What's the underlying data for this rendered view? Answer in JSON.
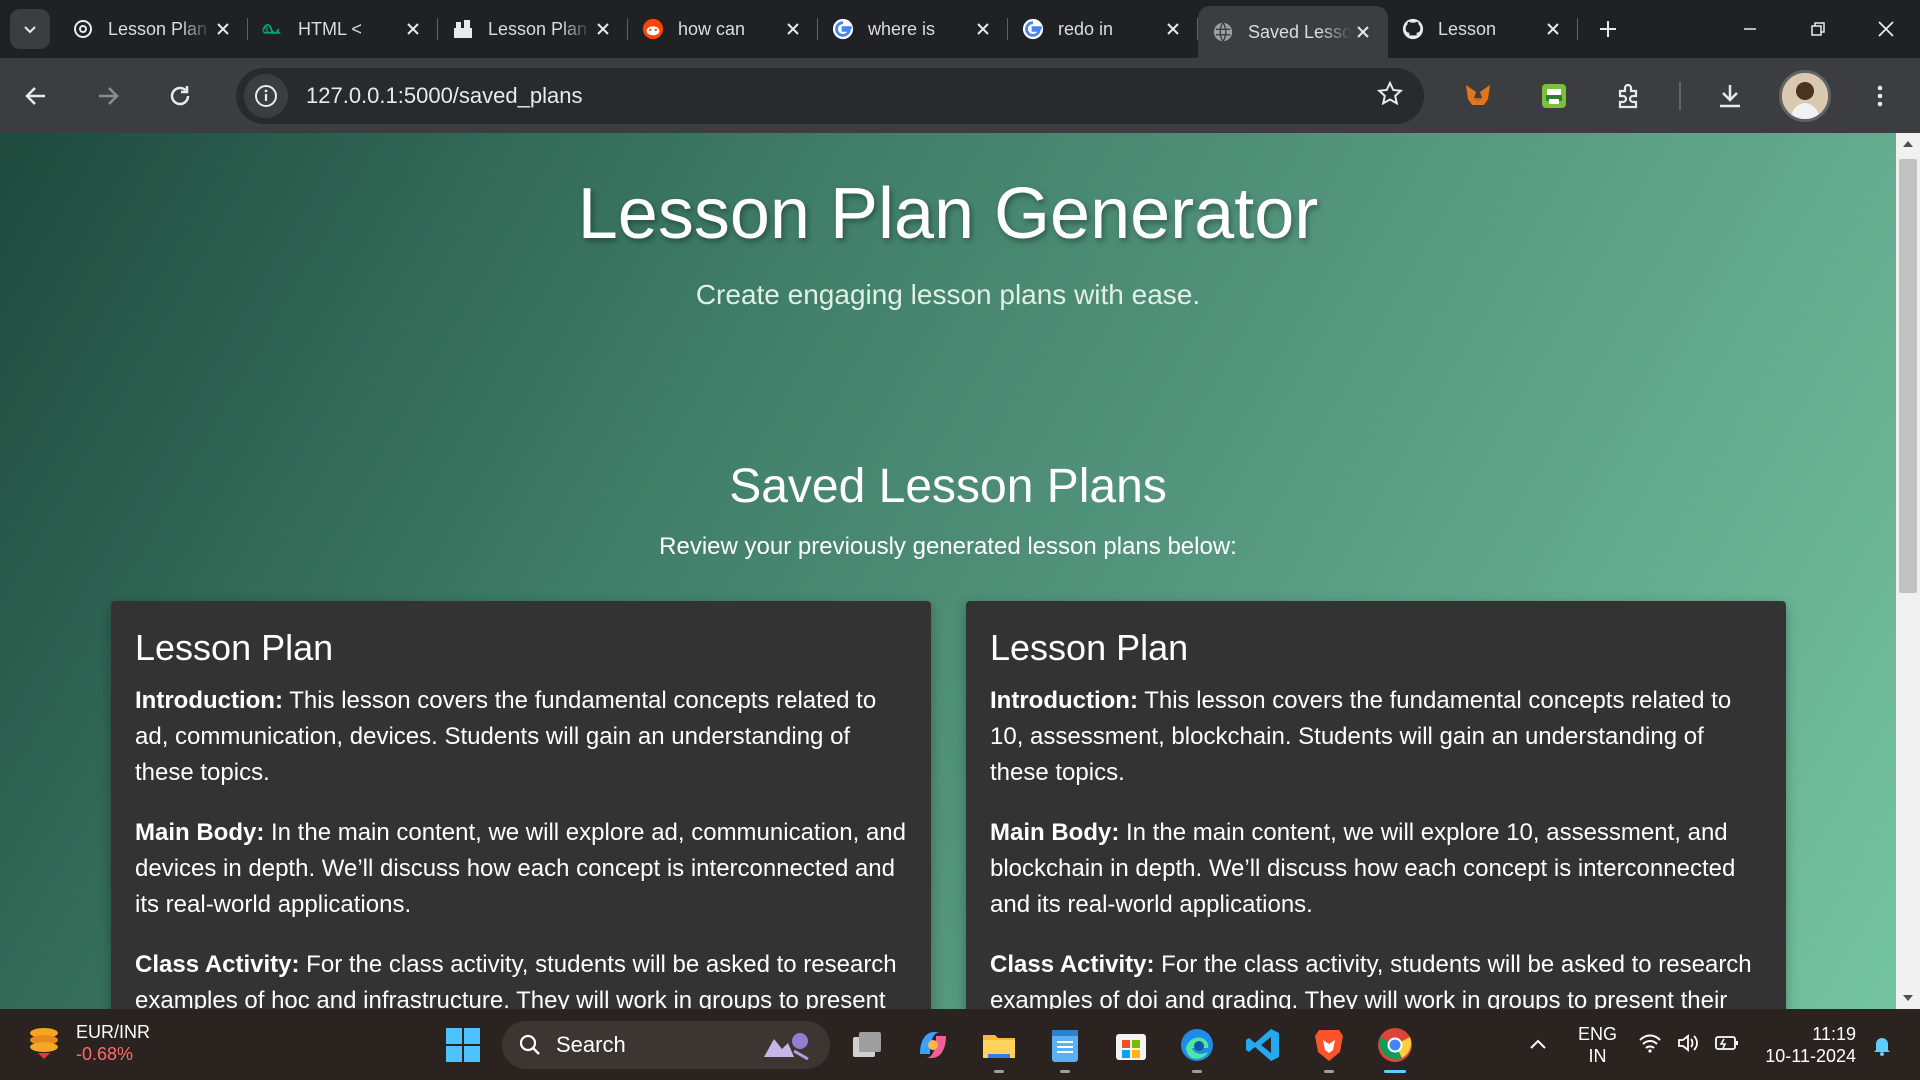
{
  "browser": {
    "tabs": [
      {
        "title": "Lesson Plan",
        "favicon": "openai-icon"
      },
      {
        "title": "HTML <",
        "favicon": "w3schools-icon"
      },
      {
        "title": "Lesson Plan",
        "favicon": "site-icon"
      },
      {
        "title": "how can",
        "favicon": "reddit-icon"
      },
      {
        "title": "where is",
        "favicon": "google-icon"
      },
      {
        "title": "redo in",
        "favicon": "google-icon"
      },
      {
        "title": "Saved Lesson",
        "favicon": "globe-icon",
        "active": true
      },
      {
        "title": "Lesson",
        "favicon": "github-icon"
      }
    ],
    "url": "127.0.0.1:5000/saved_plans"
  },
  "page": {
    "title": "Lesson Plan Generator",
    "subtitle": "Create engaging lesson plans with ease.",
    "section_title": "Saved Lesson Plans",
    "section_subtitle": "Review your previously generated lesson plans below:",
    "plans": [
      {
        "heading": "Lesson Plan",
        "intro_label": "Introduction:",
        "intro": " This lesson covers the fundamental concepts related to ad, communication, devices. Students will gain an understanding of these topics.",
        "body_label": "Main Body:",
        "body": " In the main content, we will explore ad, communication, and devices in depth. We’ll discuss how each concept is interconnected and its real-world applications.",
        "activity_label": "Class Activity:",
        "activity": " For the class activity, students will be asked to research examples of hoc and infrastructure. They will work in groups to present"
      },
      {
        "heading": "Lesson Plan",
        "intro_label": "Introduction:",
        "intro": " This lesson covers the fundamental concepts related to 10, assessment, blockchain. Students will gain an understanding of these topics.",
        "body_label": "Main Body:",
        "body": " In the main content, we will explore 10, assessment, and blockchain in depth. We’ll discuss how each concept is interconnected and its real-world applications.",
        "activity_label": "Class Activity:",
        "activity": " For the class activity, students will be asked to research examples of doi and grading. They will work in groups to present their"
      }
    ]
  },
  "taskbar": {
    "widget_name": "EUR/INR",
    "widget_value": "-0.68%",
    "search_label": "Search",
    "lang": "ENG",
    "region": "IN",
    "time": "11:19",
    "date": "10-11-2024"
  },
  "colors": {
    "page_gradient_start": "#1f4a3d",
    "page_gradient_end": "#74c3a1",
    "card_bg": "#333333",
    "widget_negative": "#ff6b6b"
  }
}
